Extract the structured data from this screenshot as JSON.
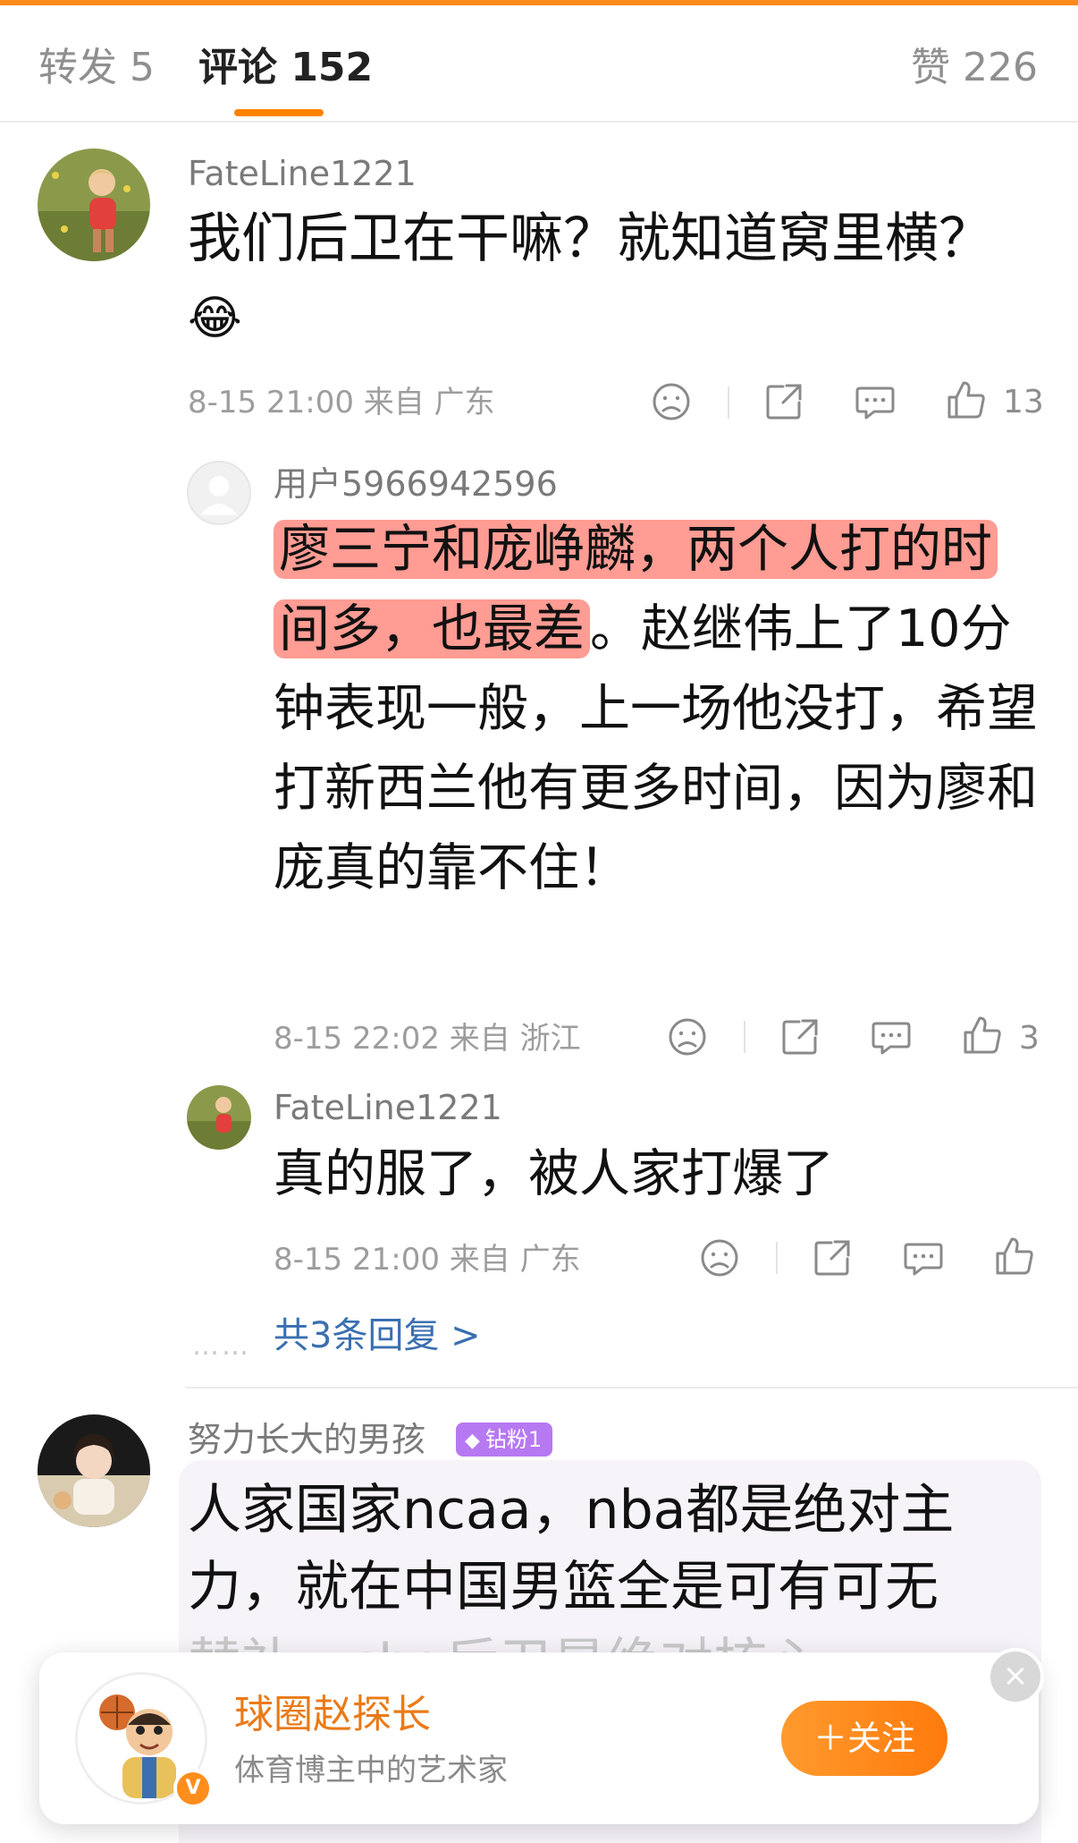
{
  "tabs": {
    "repost": "转发 5",
    "comment": "评论 152",
    "like": "赞 226"
  },
  "comments": [
    {
      "user": "FateLine1221",
      "text": "我们后卫在干嘛？就知道窝里横？",
      "emoji": "😂",
      "meta": "8-15 21:00 来自 广东",
      "likes": "13"
    },
    {
      "user": "努力长大的男孩",
      "badge": "钻粉1",
      "text_line1": "人家国家ncaa，nba都是绝对主",
      "text_line2": "力，就在中国男篮全是可有可无",
      "text_line3": "替补，cba后卫是绝对核心"
    }
  ],
  "replies": [
    {
      "user": "用户5966942596",
      "text_highlight": "廖三宁和庞峥麟，两个人打的时间多，也最差",
      "text_rest": "。赵继伟上了10分钟表现一般，上一场他没打，希望打新西兰他有更多时间，因为廖和庞真的靠不住！",
      "meta": "8-15 22:02 来自 浙江",
      "likes": "3"
    },
    {
      "user": "FateLine1221",
      "text": "真的服了，被人家打爆了",
      "meta": "8-15 21:00 来自 广东",
      "likes": ""
    }
  ],
  "more_replies": "共3条回复 >",
  "more_dots": "……",
  "follow_card": {
    "name": "球圈赵探长",
    "desc": "体育博主中的艺术家",
    "follow_label": "＋关注",
    "verified": "V",
    "close": "×"
  },
  "colors": {
    "accent": "#ff8200",
    "highlight": "#ff9c93",
    "link": "#3a6fb0",
    "badge": "#b679f2"
  },
  "icons": [
    "dislike-icon",
    "share-icon",
    "comment-icon",
    "like-icon",
    "close-icon",
    "verified-icon",
    "diamond-icon"
  ]
}
